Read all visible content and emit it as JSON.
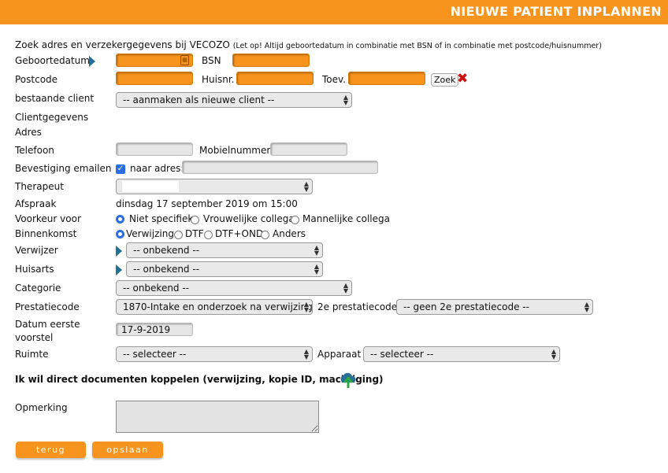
{
  "header": {
    "title": "NIEUWE PATIENT INPLANNEN"
  },
  "notice": {
    "main": "Zoek adres en verzekergegevens bij VECOZO",
    "note": "(Let op! Altijd geboortedatum in combinatie met BSN of in combinatie met postcode/huisnummer)"
  },
  "labels": {
    "geboortedatum": "Geboortedatum",
    "bsn": "BSN",
    "postcode": "Postcode",
    "huisnr": "Huisnr.",
    "toev": "Toev.",
    "bestaande_client": "bestaande client",
    "clientgegevens": "Clientgegevens",
    "adres": "Adres",
    "telefoon": "Telefoon",
    "mobielnummer": "Mobielnummer",
    "bevestiging_emailen": "Bevestiging emailen",
    "naar_adres": "naar adres:",
    "therapeut": "Therapeut",
    "afspraak": "Afspraak",
    "voorkeur_voor": "Voorkeur voor",
    "binnenkomst": "Binnenkomst",
    "verwijzer": "Verwijzer",
    "huisarts": "Huisarts",
    "categorie": "Categorie",
    "prestatiecode": "Prestatiecode",
    "tweede_prestatiecode": "2e prestatiecode",
    "datum_eerste_voorstel_1": "Datum eerste",
    "datum_eerste_voorstel_2": "voorstel",
    "ruimte": "Ruimte",
    "apparaat": "Apparaat",
    "documenten": "Ik wil direct documenten koppelen (verwijzing, kopie ID, machtiging)",
    "opmerking": "Opmerking"
  },
  "buttons": {
    "zoek": "Zoek",
    "terug": "terug",
    "opslaan": "opslaan"
  },
  "fields": {
    "afspraak_value": "dinsdag 17 september 2019 om 15:00",
    "datum_eerste_voorstel": "17-9-2019"
  },
  "selects": {
    "bestaande_client": "-- aanmaken als nieuwe client --",
    "therapeut": "",
    "verwijzer": "-- onbekend --",
    "huisarts": "-- onbekend --",
    "categorie": "-- onbekend --",
    "prestatiecode": "1870-Intake en onderzoek na verwijzing",
    "tweede_prestatiecode": "-- geen 2e prestatiecode --",
    "ruimte": "-- selecteer --",
    "apparaat": "-- selecteer --"
  },
  "voorkeur_options": [
    "Niet specifiek",
    "Vrouwelijke collega",
    "Mannelijke collega"
  ],
  "binnenkomst_options": [
    "Verwijzing",
    "DTF",
    "DTF+OND",
    "Anders"
  ],
  "colors": {
    "accent": "#f7941d",
    "radio_selected": "#2a6ee6",
    "indicator": "#1f6f96",
    "delete": "#cc1111"
  }
}
